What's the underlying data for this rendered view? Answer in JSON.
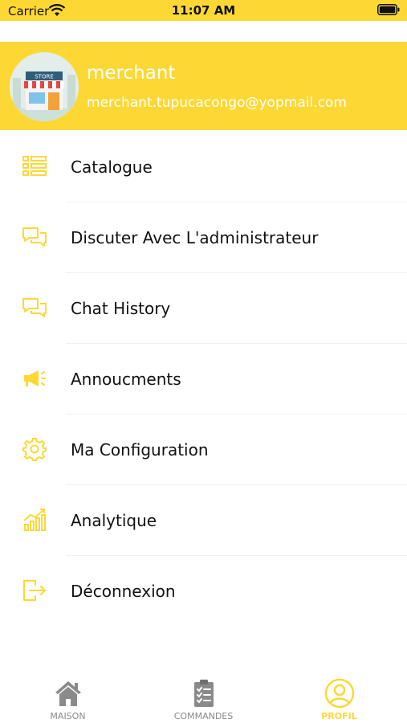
{
  "status_bar": {
    "carrier": "Carrier",
    "time": "11:07 AM"
  },
  "profile": {
    "name": "merchant",
    "email": "merchant.tupucacongo@yopmail.com",
    "avatar_sign": "STORE"
  },
  "menu": {
    "items": [
      {
        "label": "Catalogue",
        "icon": "list-icon"
      },
      {
        "label": "Discuter Avec L'administrateur",
        "icon": "chat-icon"
      },
      {
        "label": "Chat History",
        "icon": "chat-icon"
      },
      {
        "label": "Annoucments",
        "icon": "megaphone-icon"
      },
      {
        "label": "Ma Configuration",
        "icon": "gear-icon"
      },
      {
        "label": "Analytique",
        "icon": "analytics-icon"
      },
      {
        "label": "Déconnexion",
        "icon": "logout-icon"
      }
    ]
  },
  "tab_bar": {
    "tabs": [
      {
        "label": "MAISON",
        "icon": "home-icon"
      },
      {
        "label": "COMMANDES",
        "icon": "clipboard-icon"
      },
      {
        "label": "PROFIL",
        "icon": "user-icon",
        "active": true
      }
    ]
  },
  "colors": {
    "accent": "#FDD835",
    "inactive": "#8a8a8a",
    "text": "#111111"
  }
}
